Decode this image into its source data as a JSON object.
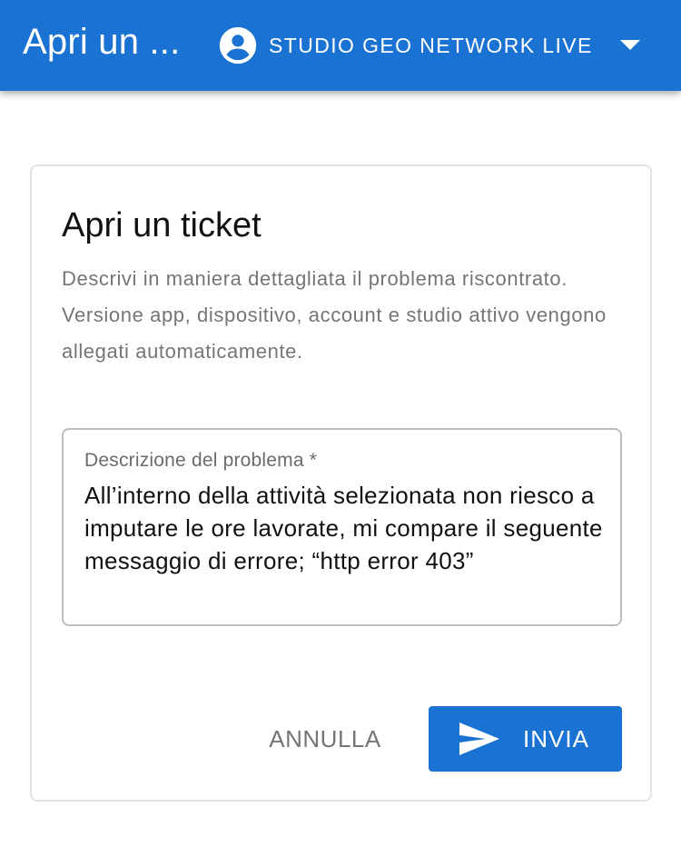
{
  "appbar": {
    "title": "Apri un ...",
    "studio_name": "STUDIO GEO NETWORK LIVE",
    "account_icon": "account-circle-icon",
    "dropdown_icon": "arrow-drop-down-icon",
    "color": "#1a72d3"
  },
  "card": {
    "title": "Apri un ticket",
    "description": "Descrivi in maniera dettagliata il problema riscontrato. Versione app, dispositivo, account e studio attivo vengono allegati automaticamente.",
    "field": {
      "label": "Descrizione del problema *",
      "value": "All’interno della attività selezionata non riesco a imputare le ore lavorate, mi compare il seguente messaggio di errore; “http error 403”"
    },
    "actions": {
      "cancel_label": "ANNULLA",
      "send_label": "INVIA",
      "send_icon": "send-icon"
    }
  }
}
